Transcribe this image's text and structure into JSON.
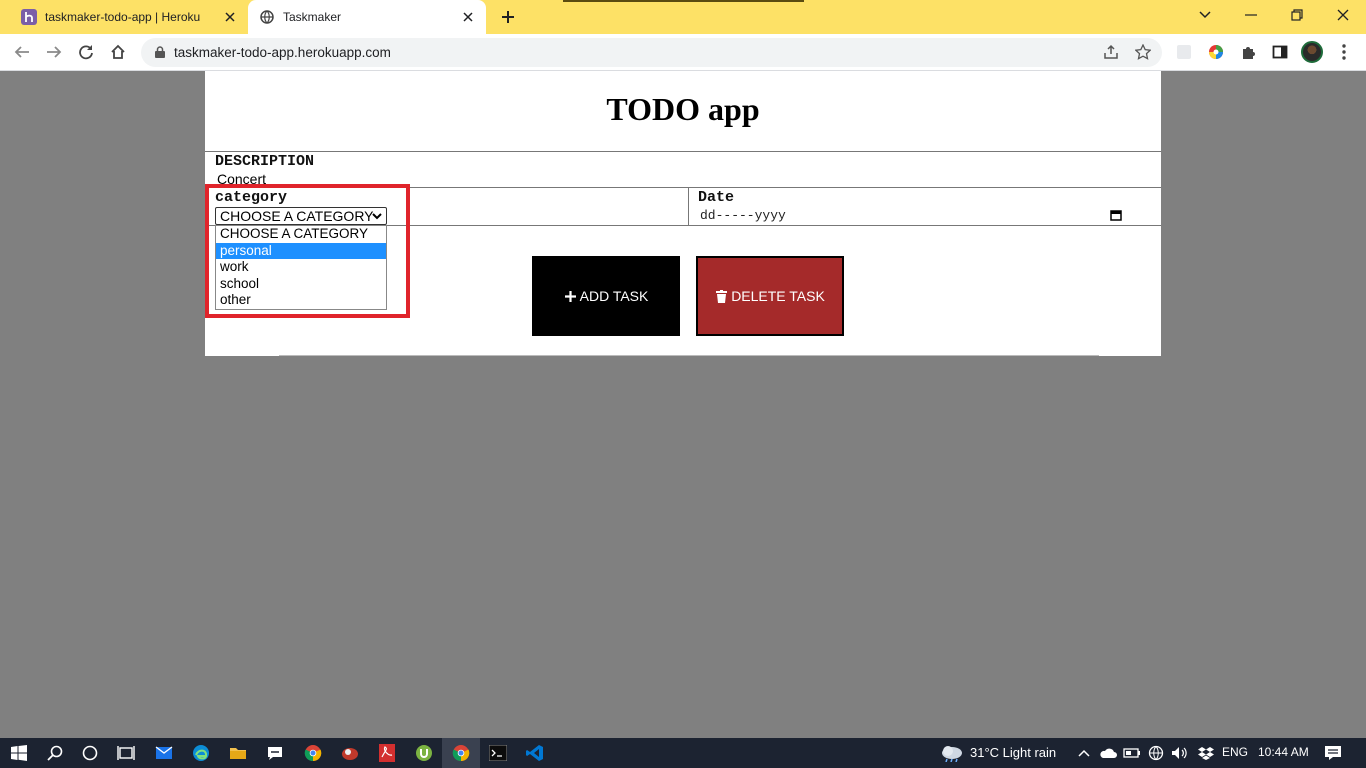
{
  "browser": {
    "tabs": [
      {
        "title": "taskmaker-todo-app | Heroku",
        "icon": "heroku-icon",
        "active": false
      },
      {
        "title": "Taskmaker",
        "icon": "globe-icon",
        "active": true
      }
    ],
    "url": "taskmaker-todo-app.herokuapp.com",
    "colors": {
      "tabstrip": "#fde166",
      "toolbar": "#ffffff"
    }
  },
  "app": {
    "title": "TODO app",
    "description_label": "DESCRIPTION",
    "description_value": "Concert",
    "category_label": "category",
    "category_selected": "CHOOSE A CATEGORY",
    "category_options": [
      "CHOOSE A CATEGORY",
      "personal",
      "work",
      "school",
      "other"
    ],
    "category_highlighted": "personal",
    "date_label": "Date",
    "date_placeholder": "dd-----yyyy",
    "add_button": "ADD TASK",
    "delete_button": "DELETE TASK",
    "colors": {
      "add": "#000000",
      "delete": "#a52a2a",
      "highlight_box": "#e0242b",
      "selection": "#1e90ff"
    }
  },
  "taskbar": {
    "weather": "31°C  Light rain",
    "language": "ENG",
    "time": "10:44 AM"
  }
}
